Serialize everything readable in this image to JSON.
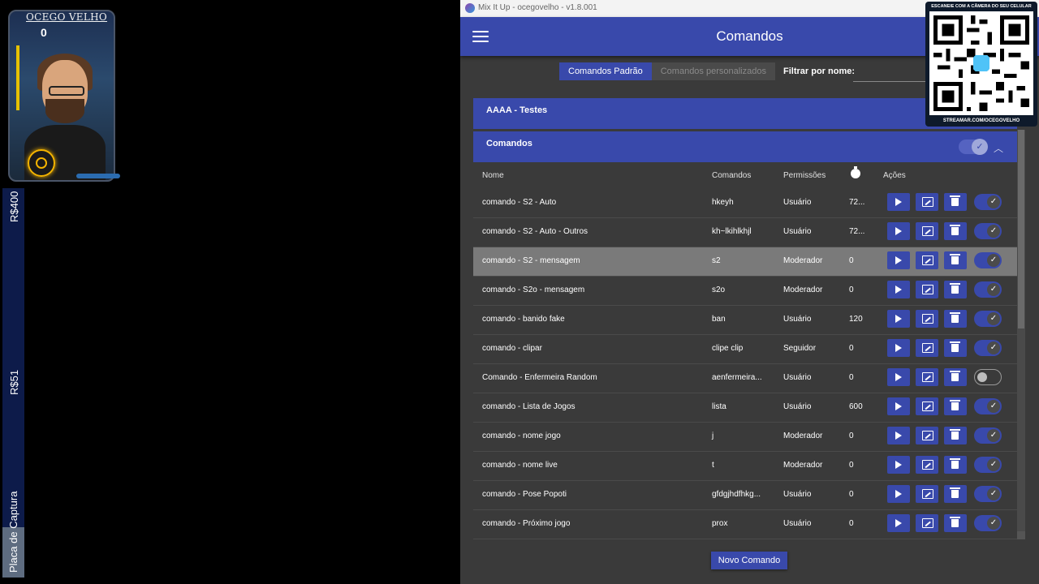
{
  "overlay": {
    "webcam_name": "OCEGO VELHO",
    "webcam_count": "0",
    "donation_top": "R$400",
    "donation_mid": "R$51",
    "capture_label": "Placa de Captura"
  },
  "window": {
    "title": "Mix It Up - ocegovelho - v1.8.001"
  },
  "appbar": {
    "page_title": "Comandos",
    "menu_icon": "hamburger-menu-icon"
  },
  "tabs": [
    {
      "label": "Comandos Padrão",
      "active": true
    },
    {
      "label": "Comandos personalizados",
      "active": false
    }
  ],
  "filter": {
    "label": "Filtrar por nome:",
    "value": ""
  },
  "groups": [
    {
      "label": "AAAA - Testes"
    },
    {
      "label": "Comandos",
      "enabled": true
    }
  ],
  "table": {
    "headers": {
      "name": "Nome",
      "commands": "Comandos",
      "permissions": "Permissões",
      "cooldown_icon": "stopwatch-icon",
      "actions": "Ações"
    },
    "rows": [
      {
        "name": "comando -  S2 - Auto",
        "cmd": "hkeyh",
        "perm": "Usuário",
        "time": "72...",
        "enabled": true
      },
      {
        "name": "comando -  S2 - Auto - Outros",
        "cmd": "kh~lkihlkhjl",
        "perm": "Usuário",
        "time": "72...",
        "enabled": true
      },
      {
        "name": "comando -  S2 - mensagem",
        "cmd": "s2",
        "perm": "Moderador",
        "time": "0",
        "enabled": true,
        "highlight": true
      },
      {
        "name": "comando -  S2o - mensagem",
        "cmd": "s2o",
        "perm": "Moderador",
        "time": "0",
        "enabled": true
      },
      {
        "name": "comando - banido fake",
        "cmd": "ban",
        "perm": "Usuário",
        "time": "120",
        "enabled": true
      },
      {
        "name": "comando - clipar",
        "cmd": "clipe clip",
        "perm": "Seguidor",
        "time": "0",
        "enabled": true
      },
      {
        "name": "Comando - Enfermeira Random",
        "cmd": "aenfermeira...",
        "perm": "Usuário",
        "time": "0",
        "enabled": false
      },
      {
        "name": "comando - Lista de Jogos",
        "cmd": "lista",
        "perm": "Usuário",
        "time": "600",
        "enabled": true
      },
      {
        "name": "comando - nome jogo",
        "cmd": "j",
        "perm": "Moderador",
        "time": "0",
        "enabled": true
      },
      {
        "name": "comando - nome live",
        "cmd": "t",
        "perm": "Moderador",
        "time": "0",
        "enabled": true
      },
      {
        "name": "comando - Pose Popoti",
        "cmd": "gfdgjhdfhkg...",
        "perm": "Usuário",
        "time": "0",
        "enabled": true
      },
      {
        "name": "comando - Próximo jogo",
        "cmd": "prox",
        "perm": "Usuário",
        "time": "0",
        "enabled": true
      }
    ]
  },
  "new_command_label": "Novo Comando",
  "qr": {
    "top_text": "ESCANEIE COM A CÂMERA DO SEU CELULAR",
    "bottom_text": "STREAMAR.COM/OCEGOVELHO"
  },
  "colors": {
    "accent": "#3949ab",
    "background": "#3a3a3a",
    "highlight_row": "#7a7a7a"
  }
}
